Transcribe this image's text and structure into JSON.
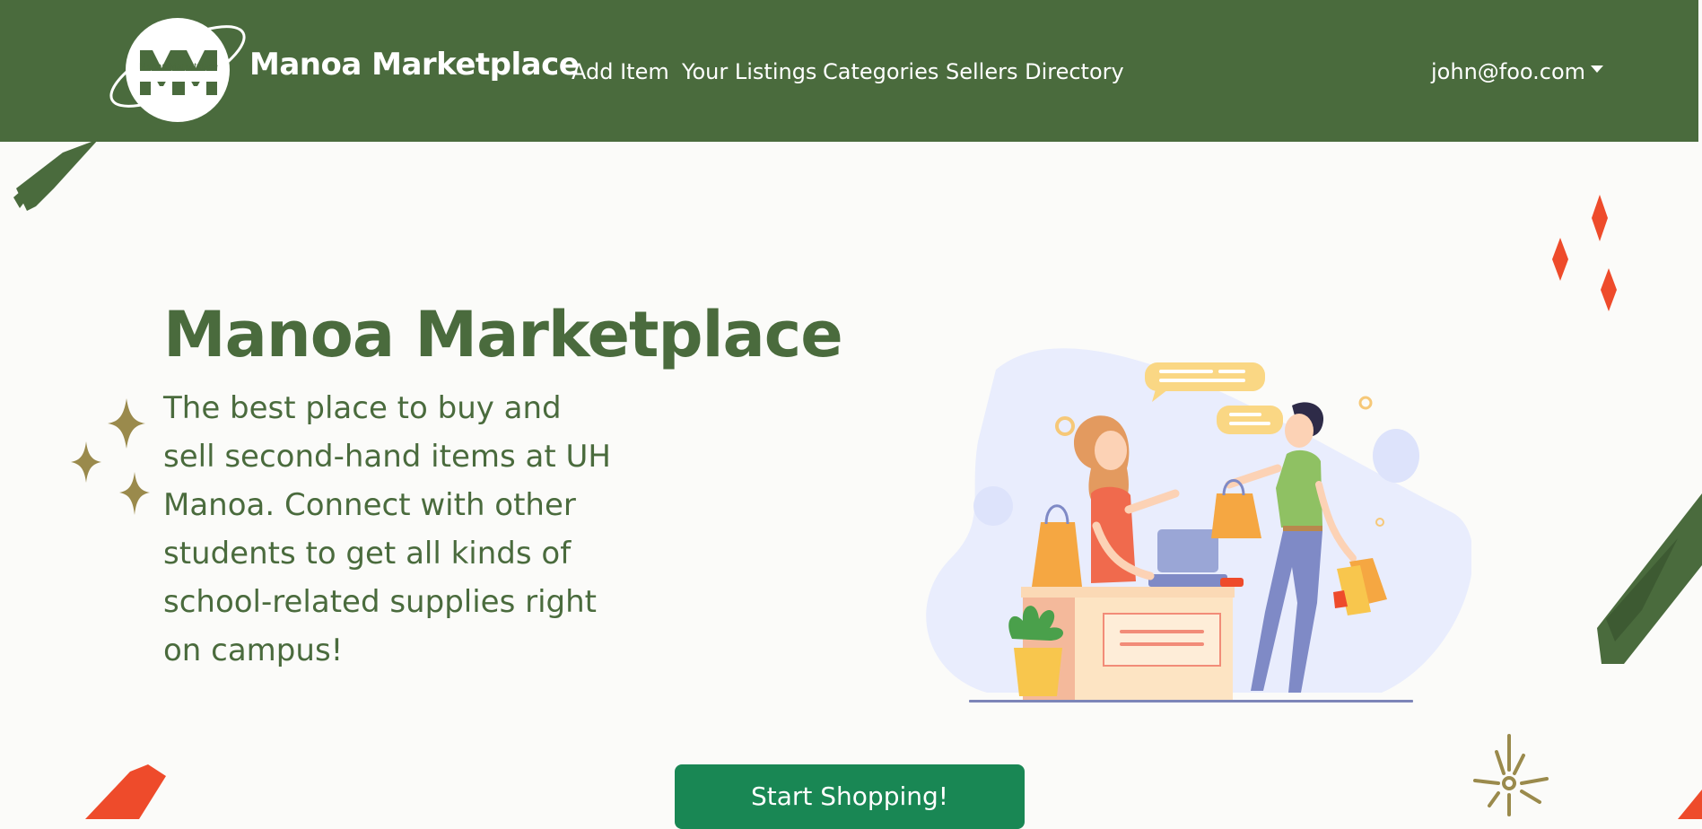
{
  "navbar": {
    "logo_text": "Manoa Marketplace",
    "brand": "Manoa Marketplace",
    "links": [
      "Add Item",
      "Your Listings",
      "Categories",
      "Sellers Directory"
    ],
    "user": "john@foo.com",
    "background": "#4a6b3d"
  },
  "hero": {
    "title": "Manoa Marketplace",
    "description": "The best place to buy and sell second-hand items at UH Manoa. Connect with other students to get all kinds of school-related supplies right on campus!",
    "cta_label": "Start Shopping!",
    "text_color": "#4a6b3d",
    "cta_color": "#198754"
  },
  "decor": {
    "accent_red": "#ee4b2b",
    "accent_gold": "#9a8a4c"
  }
}
